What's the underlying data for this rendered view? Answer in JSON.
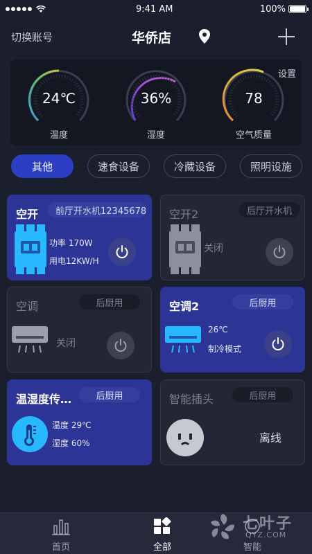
{
  "status_bar": {
    "time": "9:41 AM",
    "battery": "100%"
  },
  "header": {
    "switch_account": "切换账号",
    "store_name": "华侨店"
  },
  "environment": {
    "settings": "设置",
    "gauges": [
      {
        "value": "24℃",
        "label": "温度",
        "colors": [
          "#3f9be0",
          "#5ac06a",
          "#c9c34a"
        ]
      },
      {
        "value": "36%",
        "label": "湿度",
        "colors": [
          "#5a3fd0",
          "#9b4fd6",
          "#c95fd0"
        ]
      },
      {
        "value": "78",
        "label": "空气质量",
        "colors": [
          "#e0843a",
          "#e0b23a",
          "#d8d44a"
        ]
      }
    ]
  },
  "tabs": [
    {
      "label": "其他",
      "active": true
    },
    {
      "label": "速食设备",
      "active": false
    },
    {
      "label": "冷藏设备",
      "active": false
    },
    {
      "label": "照明设施",
      "active": false
    }
  ],
  "devices": [
    {
      "title": "空开",
      "tag": "前厅开水机12345678",
      "lines": [
        "功率 170W",
        "用电12KW/H"
      ],
      "status": "on",
      "icon": "breaker-icon"
    },
    {
      "title": "空开2",
      "tag": "后厅开水机",
      "lines": [
        "关闭"
      ],
      "status": "off",
      "icon": "breaker-icon"
    },
    {
      "title": "空调",
      "tag": "后厨用",
      "lines": [
        "关闭"
      ],
      "status": "off",
      "icon": "air-conditioner-icon"
    },
    {
      "title": "空调2",
      "tag": "后厨用",
      "lines": [
        "26℃",
        "制冷模式"
      ],
      "status": "on",
      "icon": "air-conditioner-icon"
    },
    {
      "title": "温湿度传…",
      "tag": "后厨用",
      "lines": [
        "温度 29℃",
        "湿度 60%"
      ],
      "status": "on",
      "icon": "thermometer-icon"
    },
    {
      "title": "智能插头",
      "tag": "后厨用",
      "lines": [
        "离线"
      ],
      "status": "offline",
      "icon": "smart-plug-icon"
    }
  ],
  "bottom_nav": [
    {
      "label": "首页",
      "icon": "chart-icon",
      "active": false
    },
    {
      "label": "全部",
      "icon": "grid-icon",
      "active": true
    },
    {
      "label": "智能",
      "icon": "smart-icon",
      "active": false
    }
  ],
  "watermark": {
    "text": "七叶子",
    "sub": "QYZ.COM"
  }
}
